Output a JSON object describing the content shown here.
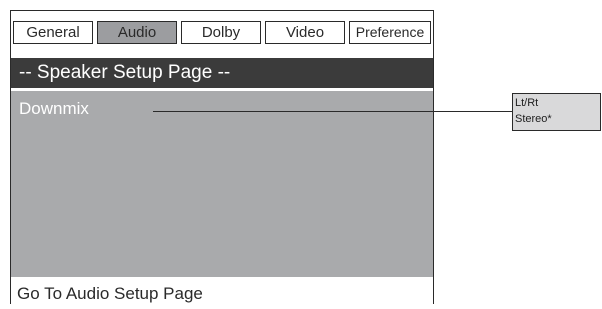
{
  "tabs": [
    {
      "label": "General",
      "active": false
    },
    {
      "label": "Audio",
      "active": true
    },
    {
      "label": "Dolby",
      "active": false
    },
    {
      "label": "Video",
      "active": false
    },
    {
      "label": "Preference",
      "active": false
    }
  ],
  "page_title": "-- Speaker Setup Page --",
  "settings": {
    "downmix_label": "Downmix"
  },
  "downmix_options": [
    {
      "label": "Lt/Rt"
    },
    {
      "label": "Stereo*"
    }
  ],
  "footer": {
    "hint": "Go To Audio Setup Page"
  },
  "colors": {
    "active_tab": "#9c9da0",
    "title_bar": "#3b3b3b",
    "content_bg": "#a9aaac",
    "options_bg": "#d9d9da"
  }
}
